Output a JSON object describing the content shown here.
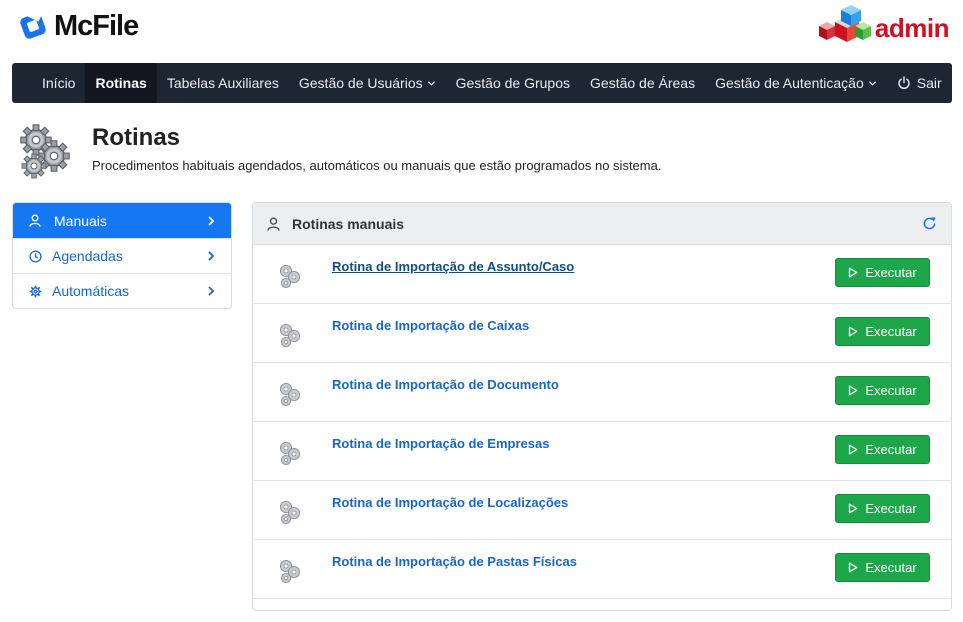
{
  "brand": {
    "name": "McFile"
  },
  "admin_logo": {
    "text": "admin"
  },
  "navbar": {
    "items": [
      {
        "label": "Início",
        "active": false,
        "dropdown": false
      },
      {
        "label": "Rotinas",
        "active": true,
        "dropdown": false
      },
      {
        "label": "Tabelas Auxiliares",
        "active": false,
        "dropdown": false
      },
      {
        "label": "Gestão de Usuários",
        "active": false,
        "dropdown": true
      },
      {
        "label": "Gestão de Grupos",
        "active": false,
        "dropdown": false
      },
      {
        "label": "Gestão de Áreas",
        "active": false,
        "dropdown": false
      },
      {
        "label": "Gestão de Autenticação",
        "active": false,
        "dropdown": true
      }
    ],
    "logout_label": "Sair"
  },
  "page": {
    "title": "Rotinas",
    "subtitle": "Procedimentos habituais agendados, automáticos ou manuais que estão programados no sistema."
  },
  "sidebar": {
    "items": [
      {
        "label": "Manuais",
        "icon": "user-icon",
        "active": true
      },
      {
        "label": "Agendadas",
        "icon": "clock-icon",
        "active": false
      },
      {
        "label": "Automáticas",
        "icon": "gear-icon",
        "active": false
      }
    ]
  },
  "panel": {
    "title": "Rotinas manuais",
    "button_label": "Executar",
    "routines": [
      {
        "title": "Rotina de Importação de Assunto/Caso",
        "visited": true
      },
      {
        "title": "Rotina de Importação de Caixas",
        "visited": false
      },
      {
        "title": "Rotina de Importação de Documento",
        "visited": false
      },
      {
        "title": "Rotina de Importação de Empresas",
        "visited": false
      },
      {
        "title": "Rotina de Importação de Localizações",
        "visited": false
      },
      {
        "title": "Rotina de Importação de Pastas Físicas",
        "visited": false
      }
    ]
  },
  "colors": {
    "navbar": "#1f2633",
    "primary": "#1677f2",
    "link": "#1766c8",
    "success": "#1ea64a",
    "admin_red": "#d01020"
  }
}
